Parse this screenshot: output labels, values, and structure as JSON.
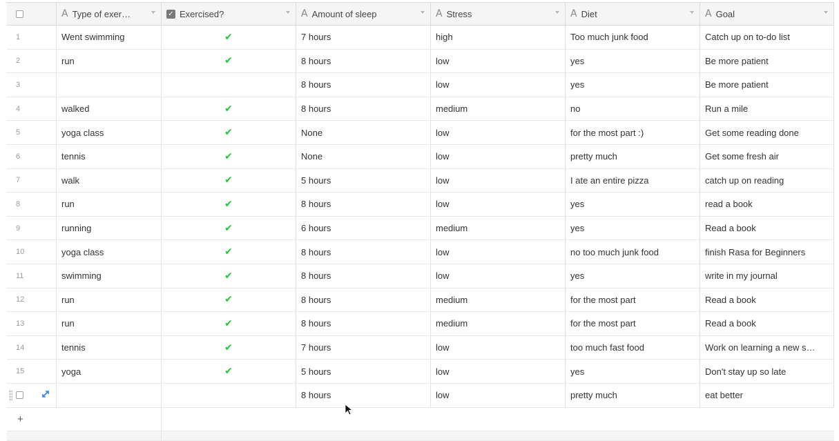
{
  "columns": [
    {
      "label": "Type of exer…",
      "icon": "text-field-icon"
    },
    {
      "label": "Exercised?",
      "icon": "checkbox-field-icon"
    },
    {
      "label": "Amount of sleep",
      "icon": "text-field-icon"
    },
    {
      "label": "Stress",
      "icon": "text-field-icon"
    },
    {
      "label": "Diet",
      "icon": "text-field-icon"
    },
    {
      "label": "Goal",
      "icon": "text-field-icon"
    }
  ],
  "rows": [
    {
      "num": "1",
      "type": "Went swimming",
      "exercised": true,
      "sleep": "7 hours",
      "stress": "high",
      "diet": "Too much junk food",
      "goal": "Catch up on to-do list"
    },
    {
      "num": "2",
      "type": "run",
      "exercised": true,
      "sleep": "8 hours",
      "stress": "low",
      "diet": "yes",
      "goal": "Be more patient"
    },
    {
      "num": "3",
      "type": "",
      "exercised": false,
      "sleep": "8 hours",
      "stress": "low",
      "diet": "yes",
      "goal": "Be more patient"
    },
    {
      "num": "4",
      "type": "walked",
      "exercised": true,
      "sleep": "8 hours",
      "stress": "medium",
      "diet": "no",
      "goal": "Run a mile"
    },
    {
      "num": "5",
      "type": "yoga class",
      "exercised": true,
      "sleep": "None",
      "stress": "low",
      "diet": "for the most part :)",
      "goal": "Get some reading done"
    },
    {
      "num": "6",
      "type": "tennis",
      "exercised": true,
      "sleep": "None",
      "stress": "low",
      "diet": "pretty much",
      "goal": "Get some fresh air"
    },
    {
      "num": "7",
      "type": "walk",
      "exercised": true,
      "sleep": "5 hours",
      "stress": "low",
      "diet": "I ate an entire pizza",
      "goal": "catch up on reading"
    },
    {
      "num": "8",
      "type": "run",
      "exercised": true,
      "sleep": "8 hours",
      "stress": "low",
      "diet": "yes",
      "goal": "read a book"
    },
    {
      "num": "9",
      "type": "running",
      "exercised": true,
      "sleep": "6 hours",
      "stress": "medium",
      "diet": "yes",
      "goal": "Read a book"
    },
    {
      "num": "10",
      "type": "yoga class",
      "exercised": true,
      "sleep": "8 hours",
      "stress": "low",
      "diet": "no too much junk food",
      "goal": "finish Rasa for Beginners"
    },
    {
      "num": "11",
      "type": "swimming",
      "exercised": true,
      "sleep": "8 hours",
      "stress": "low",
      "diet": "yes",
      "goal": "write in my journal"
    },
    {
      "num": "12",
      "type": "run",
      "exercised": true,
      "sleep": "8 hours",
      "stress": "medium",
      "diet": "for the most part",
      "goal": "Read a book"
    },
    {
      "num": "13",
      "type": "run",
      "exercised": true,
      "sleep": "8 hours",
      "stress": "medium",
      "diet": "for the most part",
      "goal": "Read a book"
    },
    {
      "num": "14",
      "type": "tennis",
      "exercised": true,
      "sleep": "7 hours",
      "stress": "low",
      "diet": "too much fast food",
      "goal": "Work on learning a new s…"
    },
    {
      "num": "15",
      "type": "yoga",
      "exercised": true,
      "sleep": "5 hours",
      "stress": "low",
      "diet": "yes",
      "goal": "Don't stay up so late"
    }
  ],
  "hover_row": {
    "type": "",
    "exercised": false,
    "sleep": "8 hours",
    "stress": "low",
    "diet": "pretty much",
    "goal": "eat better"
  },
  "add_row_label": "+",
  "check_glyph": "✔",
  "colors": {
    "check": "#20c933",
    "expand": "#2d7ff9",
    "header_bg": "#f5f5f5"
  }
}
